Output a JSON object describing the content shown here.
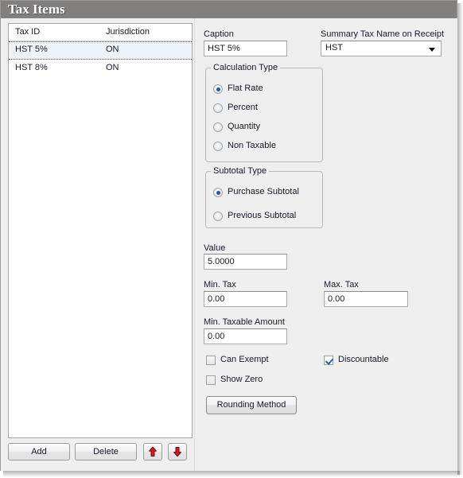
{
  "window": {
    "title": "Tax Items"
  },
  "list": {
    "columns": [
      "Tax ID",
      "Jurisdiction"
    ],
    "rows": [
      {
        "tax_id": "HST 5%",
        "jurisdiction": "ON",
        "selected": true
      },
      {
        "tax_id": "HST 8%",
        "jurisdiction": "ON",
        "selected": false
      }
    ]
  },
  "toolbar": {
    "add_label": "Add",
    "delete_label": "Delete",
    "move_up_icon": "arrow-up-icon",
    "move_down_icon": "arrow-down-icon",
    "arrow_color": "#e8141c"
  },
  "details": {
    "caption": {
      "label": "Caption",
      "value": "HST 5%"
    },
    "summary_tax_name": {
      "label": "Summary Tax Name on Receipt",
      "value": "HST",
      "options": [
        "HST"
      ]
    },
    "calculation_type": {
      "label": "Calculation Type",
      "options": [
        {
          "label": "Flat Rate",
          "selected": true
        },
        {
          "label": "Percent",
          "selected": false
        },
        {
          "label": "Quantity",
          "selected": false
        },
        {
          "label": "Non Taxable",
          "selected": false
        }
      ]
    },
    "subtotal_type": {
      "label": "Subtotal Type",
      "options": [
        {
          "label": "Purchase Subtotal",
          "selected": true
        },
        {
          "label": "Previous Subtotal",
          "selected": false
        }
      ]
    },
    "value": {
      "label": "Value",
      "value": "5.0000"
    },
    "min_tax": {
      "label": "Min. Tax",
      "value": "0.00"
    },
    "max_tax": {
      "label": "Max. Tax",
      "value": "0.00"
    },
    "min_taxable_amount": {
      "label": "Min. Taxable Amount",
      "value": "0.00"
    },
    "can_exempt": {
      "label": "Can Exempt",
      "checked": false
    },
    "show_zero": {
      "label": "Show Zero",
      "checked": false
    },
    "discountable": {
      "label": "Discountable",
      "checked": true
    },
    "rounding_method": {
      "label": "Rounding Method"
    }
  },
  "colors": {
    "titlebar": "#827f7f",
    "panel": "#efefef",
    "selection": "#eef2f9",
    "radio_dot": "#1a5fa8",
    "check_mark": "#1f63ad"
  }
}
